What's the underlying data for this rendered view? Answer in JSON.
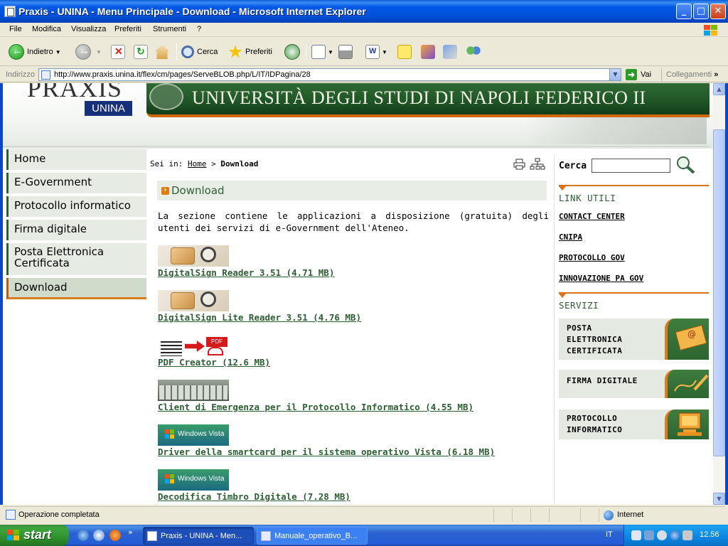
{
  "window": {
    "title": "Praxis - UNINA - Menu Principale - Download - Microsoft Internet Explorer"
  },
  "menu": [
    "File",
    "Modifica",
    "Visualizza",
    "Preferiti",
    "Strumenti",
    "?"
  ],
  "toolbar": {
    "back_label": "Indietro",
    "search_label": "Cerca",
    "favorites_label": "Preferiti"
  },
  "address": {
    "label": "Indirizzo",
    "url": "http://www.praxis.unina.it/flex/cm/pages/ServeBLOB.php/L/IT/IDPagina/28",
    "go_label": "Vai",
    "links_label": "Collegamenti"
  },
  "site": {
    "logo_text": "PRAXIS",
    "logo_badge": "UNINA",
    "university": "UNIVERSITÀ DEGLI STUDI DI NAPOLI FEDERICO II"
  },
  "nav": [
    {
      "label": "Home"
    },
    {
      "label": "E-Government"
    },
    {
      "label": "Protocollo informatico"
    },
    {
      "label": "Firma digitale"
    },
    {
      "label": "Posta Elettronica Certificata"
    },
    {
      "label": "Download"
    }
  ],
  "breadcrumb": {
    "prefix": "Sei in:",
    "home": "Home",
    "sep": ">",
    "current": "Download"
  },
  "content": {
    "title": "Download",
    "intro": "La sezione contiene le applicazioni a disposizione (gratuita) degli utenti dei servizi di e-Government dell'Ateneo.",
    "downloads": [
      {
        "label": "DigitalSign Reader 3.51 (4.71 MB)"
      },
      {
        "label": "DigitalSign Lite Reader 3.51 (4.76 MB)"
      },
      {
        "label": "PDF Creator (12.6 MB)"
      },
      {
        "label": "Client di Emergenza per il Protocollo Informatico (4.55 MB)"
      },
      {
        "label": "Driver della smartcard per il sistema operativo Vista (6.18 MB)"
      },
      {
        "label": "Decodifica Timbro Digitale (7.28 MB)"
      }
    ],
    "pdf_badge": "PDF",
    "vista_text": "Windows Vista"
  },
  "right": {
    "search_label": "Cerca",
    "search_value": "",
    "links_title": "LINK UTILI",
    "links": [
      "CONTACT CENTER",
      "CNIPA",
      "PROTOCOLLO GOV",
      "INNOVAZIONE PA GOV"
    ],
    "services_title": "SERVIZI",
    "services": [
      {
        "line1": "POSTA",
        "line2": "ELETTRONICA",
        "line3": "CERTIFICATA"
      },
      {
        "line1": "FIRMA DIGITALE"
      },
      {
        "line1": "PROTOCOLLO",
        "line2": "INFORMATICO"
      }
    ]
  },
  "status": {
    "text": "Operazione completata",
    "zone": "Internet"
  },
  "taskbar": {
    "start": "start",
    "tasks": [
      "Praxis - UNINA - Men...",
      "Manuale_operativo_B..."
    ],
    "lang": "IT",
    "clock": "12.56"
  }
}
